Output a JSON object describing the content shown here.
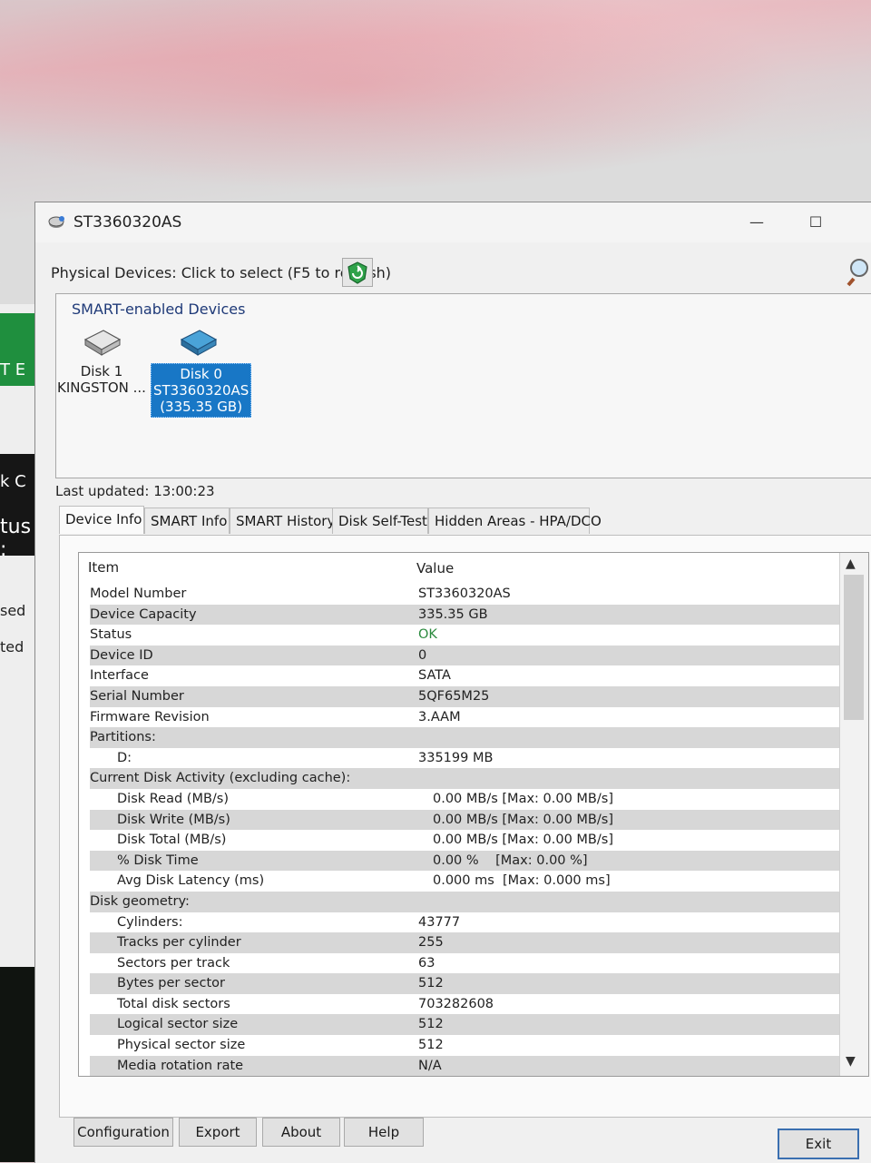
{
  "window": {
    "title": "ST3360320AS"
  },
  "toolbar": {
    "physical_label": "Physical Devices: Click to select (F5 to refresh)"
  },
  "devices": {
    "header": "SMART-enabled Devices",
    "items": [
      {
        "line1": "Disk 1",
        "line2": "KINGSTON ...",
        "line3": "",
        "selected": false
      },
      {
        "line1": "Disk 0",
        "line2": "ST3360320AS",
        "line3": "(335.35 GB)",
        "selected": true
      }
    ]
  },
  "last_updated": "Last updated: 13:00:23",
  "tabs": [
    "Device Info",
    "SMART Info",
    "SMART History",
    "Disk Self-Test",
    "Hidden Areas - HPA/DCO"
  ],
  "table": {
    "col_item": "Item",
    "col_value": "Value",
    "rows": [
      {
        "k": "Model Number",
        "v": "ST3360320AS"
      },
      {
        "k": "Device Capacity",
        "v": "335.35 GB"
      },
      {
        "k": "Status",
        "v": "OK"
      },
      {
        "k": "Device ID",
        "v": "0"
      },
      {
        "k": "Interface",
        "v": "SATA"
      },
      {
        "k": "Serial Number",
        "v": "5QF65M25"
      },
      {
        "k": "Firmware Revision",
        "v": "3.AAM"
      },
      {
        "k": "Partitions:",
        "v": ""
      },
      {
        "k": "D:",
        "v": "335199 MB"
      },
      {
        "k": "Current Disk Activity (excluding cache):",
        "v": ""
      },
      {
        "k": "Disk Read (MB/s)",
        "v": "0.00 MB/s [Max: 0.00 MB/s]"
      },
      {
        "k": "Disk Write (MB/s)",
        "v": "0.00 MB/s [Max: 0.00 MB/s]"
      },
      {
        "k": "Disk Total (MB/s)",
        "v": "0.00 MB/s [Max: 0.00 MB/s]"
      },
      {
        "k": "% Disk Time",
        "v": "0.00 %    [Max: 0.00 %]"
      },
      {
        "k": "Avg Disk Latency (ms)",
        "v": "0.000 ms  [Max: 0.000 ms]"
      },
      {
        "k": "Disk geometry:",
        "v": ""
      },
      {
        "k": "Cylinders:",
        "v": "43777"
      },
      {
        "k": "Tracks per cylinder",
        "v": "255"
      },
      {
        "k": "Sectors per track",
        "v": "63"
      },
      {
        "k": "Bytes per sector",
        "v": "512"
      },
      {
        "k": "Total disk sectors",
        "v": "703282608"
      },
      {
        "k": "Logical sector size",
        "v": "512"
      },
      {
        "k": "Physical sector size",
        "v": "512"
      },
      {
        "k": "Media rotation rate",
        "v": "N/A"
      }
    ]
  },
  "buttons": {
    "configuration": "Configuration",
    "export": "Export",
    "about": "About",
    "help": "Help",
    "exit": "Exit"
  },
  "background": {
    "green_text": "T E",
    "dark_a": "k   C",
    "dark_b": "tus :",
    "side1": "sed",
    "side2": "ted"
  }
}
